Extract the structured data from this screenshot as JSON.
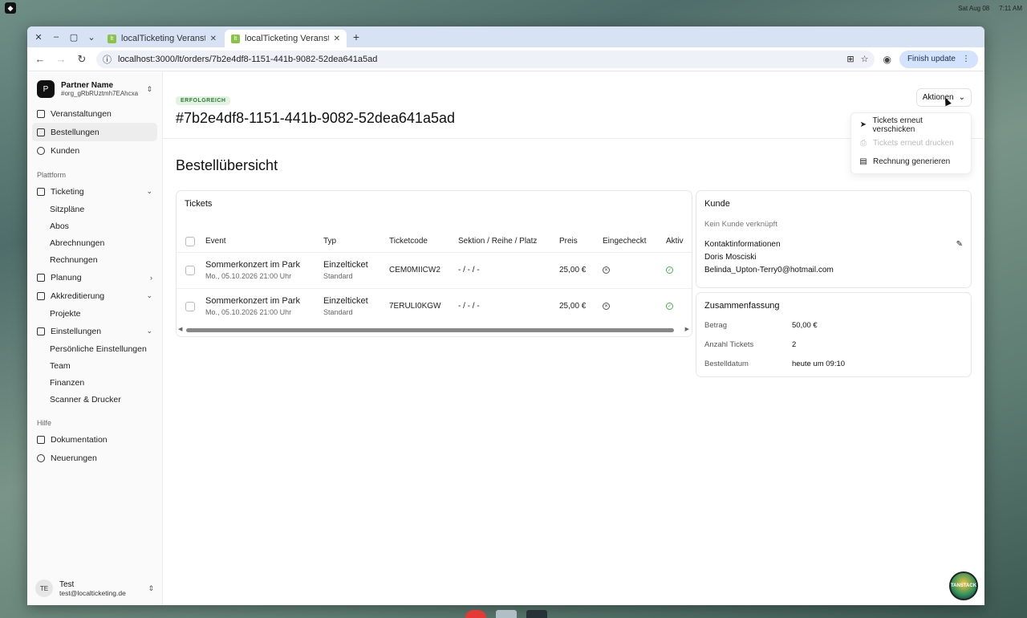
{
  "os": {
    "date": "Sat Aug 08",
    "time": "7:11 AM"
  },
  "browser": {
    "tabs": [
      {
        "title": "localTicketing Veransta"
      },
      {
        "title": "localTicketing Veransta"
      }
    ],
    "url": "localhost:3000/lt/orders/7b2e4df8-1151-441b-9082-52dea641a5ad",
    "finish_update": "Finish update"
  },
  "sidebar": {
    "org": {
      "logo": "P",
      "name": "Partner Name",
      "id": "#org_gRbRUztmh7EAhcxa"
    },
    "main_items": [
      "Veranstaltungen",
      "Bestellungen",
      "Kunden"
    ],
    "platform_label": "Plattform",
    "ticketing": {
      "label": "Ticketing",
      "children": [
        "Sitzpläne",
        "Abos",
        "Abrechnungen",
        "Rechnungen"
      ]
    },
    "planung": {
      "label": "Planung"
    },
    "akkreditierung": {
      "label": "Akkreditierung",
      "children": [
        "Projekte"
      ]
    },
    "einstellungen": {
      "label": "Einstellungen",
      "children": [
        "Persönliche Einstellungen",
        "Team",
        "Finanzen",
        "Scanner & Drucker"
      ]
    },
    "help_label": "Hilfe",
    "help_items": [
      "Dokumentation",
      "Neuerungen"
    ],
    "user": {
      "initials": "TE",
      "name": "Test",
      "email": "test@localticketing.de"
    }
  },
  "header": {
    "status": "ERFOLGREICH",
    "order_id": "#7b2e4df8-1151-441b-9082-52dea641a5ad",
    "actions_label": "Aktionen"
  },
  "actions_menu": [
    {
      "label": "Tickets erneut verschicken",
      "disabled": false
    },
    {
      "label": "Tickets erneut drucken",
      "disabled": true
    },
    {
      "label": "Rechnung generieren",
      "disabled": false
    }
  ],
  "section_title": "Bestellübersicht",
  "tickets": {
    "title": "Tickets",
    "columns": [
      "Event",
      "Typ",
      "Ticketcode",
      "Sektion / Reihe / Platz",
      "Preis",
      "Eingecheckt",
      "Aktiv"
    ],
    "rows": [
      {
        "event": "Sommerkonzert im Park",
        "date": "Mo., 05.10.2026 21:00 Uhr",
        "typ": "Einzelticket",
        "typ_sub": "Standard",
        "code": "CEM0MIICW2",
        "seat": "- / - / -",
        "price": "25,00 €"
      },
      {
        "event": "Sommerkonzert im Park",
        "date": "Mo., 05.10.2026 21:00 Uhr",
        "typ": "Einzelticket",
        "typ_sub": "Standard",
        "code": "7ERULI0KGW",
        "seat": "- / - / -",
        "price": "25,00 €"
      }
    ]
  },
  "kunde": {
    "title": "Kunde",
    "none_linked": "Kein Kunde verknüpft",
    "contact_label": "Kontaktinformationen",
    "name": "Doris Mosciski",
    "email": "Belinda_Upton-Terry0@hotmail.com"
  },
  "summary": {
    "title": "Zusammenfassung",
    "rows": [
      {
        "key": "Betrag",
        "value": "50,00 €"
      },
      {
        "key": "Anzahl Tickets",
        "value": "2"
      },
      {
        "key": "Bestelldatum",
        "value": "heute um 09:10"
      }
    ]
  },
  "devtools_badge": "TANSTACK"
}
